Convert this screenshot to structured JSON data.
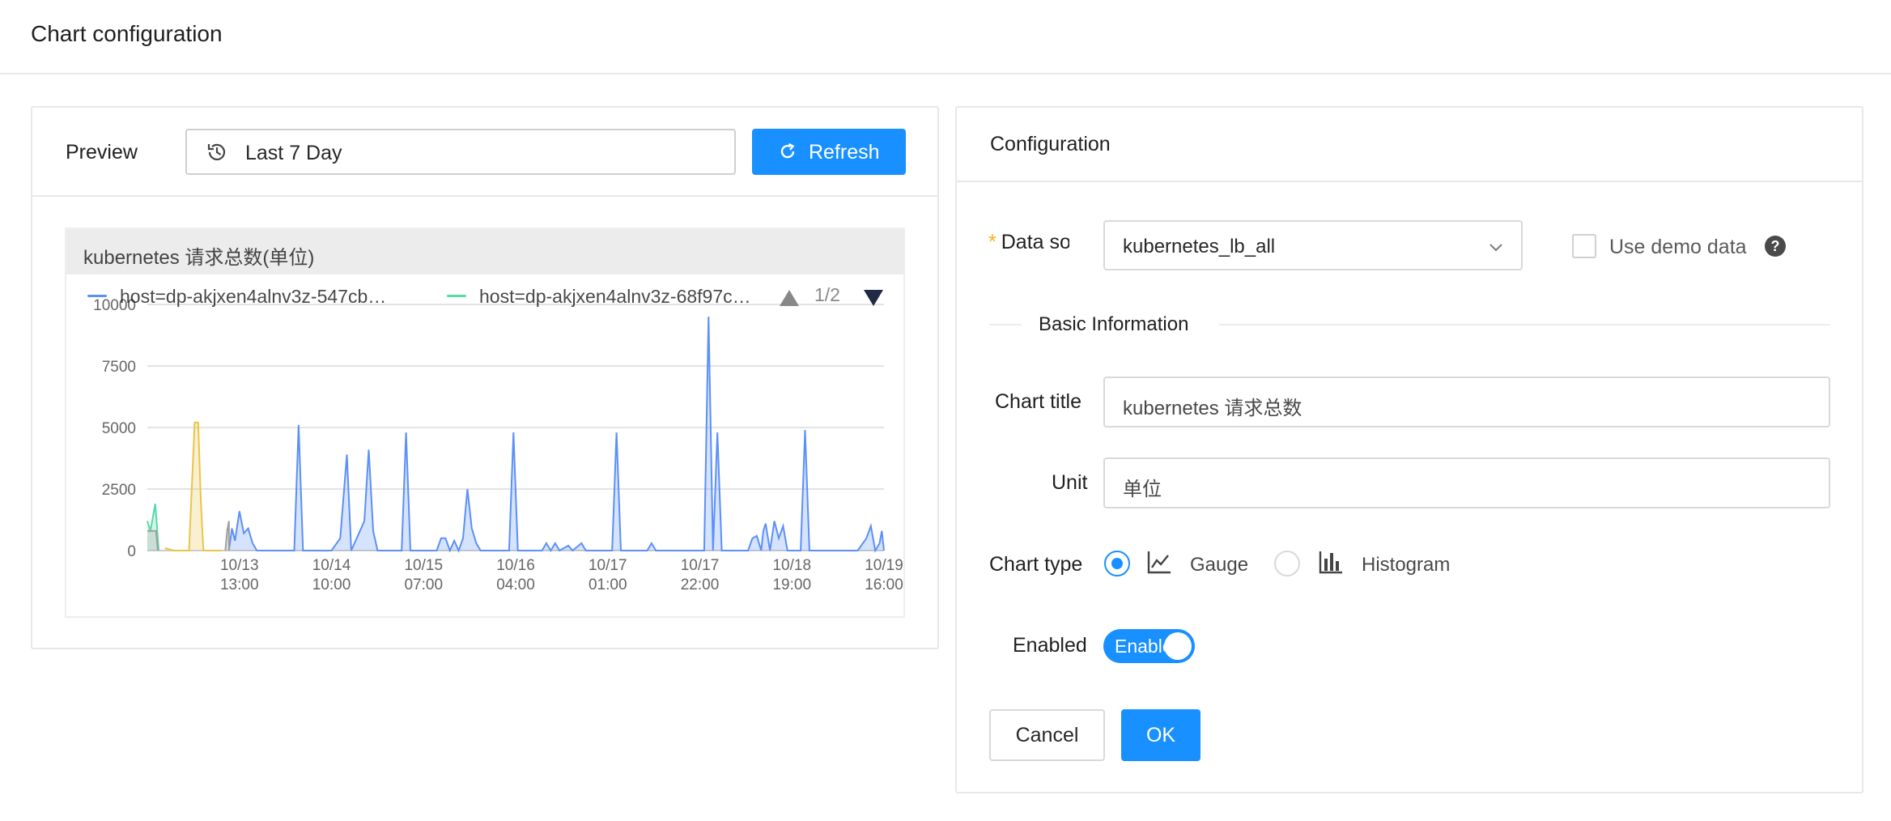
{
  "header": {
    "title": "Chart configuration"
  },
  "preview": {
    "label": "Preview",
    "time_range": "Last 7 Day",
    "refresh_label": "Refresh",
    "chart": {
      "title": "kubernetes 请求总数(单位)",
      "legend": [
        {
          "label": "host=dp-akjxen4alnv3z-547cb…",
          "color": "#5b8ff9"
        },
        {
          "label": "host=dp-akjxen4alnv3z-68f97c…",
          "color": "#5ad8a6"
        }
      ],
      "legend_page": "1/2"
    }
  },
  "chart_data": {
    "type": "area",
    "title": "kubernetes 请求总数(单位)",
    "ylim": [
      0,
      10000
    ],
    "yticks": [
      "0",
      "2500",
      "5000",
      "7500",
      "10000"
    ],
    "x_range_hours": [
      0,
      168
    ],
    "xticks": [
      {
        "label": [
          "10/13",
          "13:00"
        ],
        "x": 21
      },
      {
        "label": [
          "10/14",
          "10:00"
        ],
        "x": 42
      },
      {
        "label": [
          "10/15",
          "07:00"
        ],
        "x": 63
      },
      {
        "label": [
          "10/16",
          "04:00"
        ],
        "x": 84
      },
      {
        "label": [
          "10/17",
          "01:00"
        ],
        "x": 105
      },
      {
        "label": [
          "10/17",
          "22:00"
        ],
        "x": 126
      },
      {
        "label": [
          "10/18",
          "19:00"
        ],
        "x": 147
      },
      {
        "label": [
          "10/19",
          "16:00"
        ],
        "x": 168
      }
    ],
    "series": [
      {
        "color": "#5b8ff9",
        "points": [
          [
            18.6,
            0
          ],
          [
            19.3,
            900
          ],
          [
            20,
            400
          ],
          [
            21,
            1600
          ],
          [
            22,
            700
          ],
          [
            23,
            900
          ],
          [
            24,
            300
          ],
          [
            25,
            0
          ],
          [
            30,
            0
          ],
          [
            33.5,
            0
          ],
          [
            34.5,
            5100
          ],
          [
            35.5,
            0
          ],
          [
            42,
            0
          ],
          [
            44,
            500
          ],
          [
            45.5,
            3900
          ],
          [
            46.5,
            0
          ],
          [
            49.5,
            1200
          ],
          [
            50.5,
            4100
          ],
          [
            51.5,
            800
          ],
          [
            52.5,
            0
          ],
          [
            58,
            0
          ],
          [
            59,
            4800
          ],
          [
            60,
            0
          ],
          [
            66,
            0
          ],
          [
            67,
            500
          ],
          [
            68,
            500
          ],
          [
            69,
            0
          ],
          [
            70,
            400
          ],
          [
            71,
            0
          ],
          [
            72,
            500
          ],
          [
            73,
            2500
          ],
          [
            74,
            900
          ],
          [
            75,
            300
          ],
          [
            76,
            0
          ],
          [
            82.5,
            0
          ],
          [
            83.5,
            4800
          ],
          [
            84.5,
            0
          ],
          [
            90,
            0
          ],
          [
            91,
            300
          ],
          [
            92,
            0
          ],
          [
            93,
            300
          ],
          [
            94,
            0
          ],
          [
            96,
            200
          ],
          [
            97,
            0
          ],
          [
            99,
            300
          ],
          [
            100,
            0
          ],
          [
            106,
            0
          ],
          [
            107,
            4800
          ],
          [
            108,
            0
          ],
          [
            114,
            0
          ],
          [
            115,
            300
          ],
          [
            116,
            0
          ],
          [
            127,
            0
          ],
          [
            128,
            9500
          ],
          [
            129,
            0
          ],
          [
            130,
            4800
          ],
          [
            131,
            0
          ],
          [
            137,
            0
          ],
          [
            138,
            500
          ],
          [
            139,
            600
          ],
          [
            140,
            0
          ],
          [
            140.5,
            800
          ],
          [
            141,
            1100
          ],
          [
            142,
            0
          ],
          [
            143,
            1200
          ],
          [
            144,
            500
          ],
          [
            145,
            1000
          ],
          [
            146,
            0
          ],
          [
            149,
            0
          ],
          [
            150,
            4900
          ],
          [
            151,
            0
          ],
          [
            162,
            0
          ],
          [
            164,
            500
          ],
          [
            165,
            1000
          ],
          [
            166,
            0
          ],
          [
            167,
            300
          ],
          [
            167.5,
            800
          ],
          [
            168,
            0
          ]
        ]
      },
      {
        "color": "#5ad8a6",
        "points": [
          [
            0,
            1200
          ],
          [
            0.7,
            800
          ],
          [
            1.8,
            1900
          ],
          [
            2.6,
            0
          ]
        ]
      },
      {
        "color": "#e8c547",
        "points": [
          [
            4,
            100
          ],
          [
            6,
            0
          ],
          [
            9.5,
            0
          ],
          [
            10,
            2000
          ],
          [
            10.8,
            5200
          ],
          [
            11.6,
            5200
          ],
          [
            12.2,
            2000
          ],
          [
            12.8,
            0
          ],
          [
            17,
            0
          ]
        ]
      },
      {
        "color": "#9e9e9e",
        "points": [
          [
            0,
            800
          ],
          [
            2,
            800
          ],
          [
            2.4,
            0
          ]
        ]
      },
      {
        "color": "#9e9e9e",
        "points": [
          [
            17.8,
            0
          ],
          [
            18.2,
            800
          ],
          [
            18.6,
            1200
          ],
          [
            18.6,
            0
          ]
        ]
      }
    ]
  },
  "config": {
    "title": "Configuration",
    "data_source": {
      "label": "Data source",
      "value": "kubernetes_lb_all"
    },
    "use_demo_label": "Use demo data",
    "help_glyph": "?",
    "section_title": "Basic Information",
    "chart_title": {
      "label": "Chart title",
      "value": "kubernetes 请求总数"
    },
    "unit": {
      "label": "Unit",
      "value": "单位"
    },
    "chart_type": {
      "label": "Chart type",
      "options": [
        "Gauge",
        "Histogram"
      ],
      "selected": "Gauge"
    },
    "enabled": {
      "label": "Enabled",
      "value": "Enabled",
      "on": true
    },
    "cancel_label": "Cancel",
    "ok_label": "OK"
  },
  "colors": {
    "primary": "#1890ff",
    "required": "#faad14"
  }
}
